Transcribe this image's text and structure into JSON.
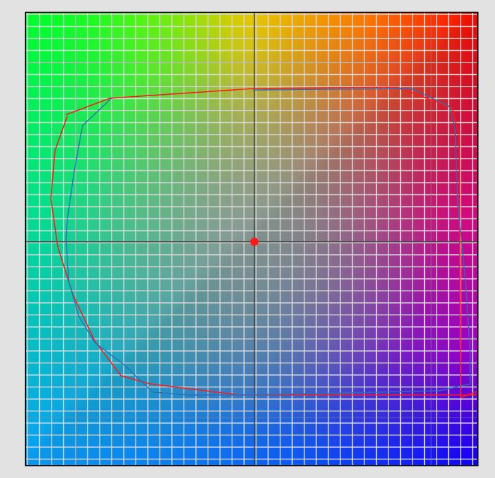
{
  "diagram": {
    "kind": "color-gamut-plane",
    "corner_colors": {
      "top_left": "#00ff1e",
      "top_right": "#ff0a00",
      "bottom_left": "#0aa2ff",
      "bottom_right": "#1100ff",
      "center": "#8f9aa0"
    },
    "grid": {
      "line_color": "#d7d7d7",
      "axis_color": "#3c3c3c"
    },
    "center_point_color": "#ff1a1a",
    "gamut_outlines": [
      {
        "color": "#ff1a1a"
      },
      {
        "color": "#2d6fb5"
      }
    ]
  }
}
